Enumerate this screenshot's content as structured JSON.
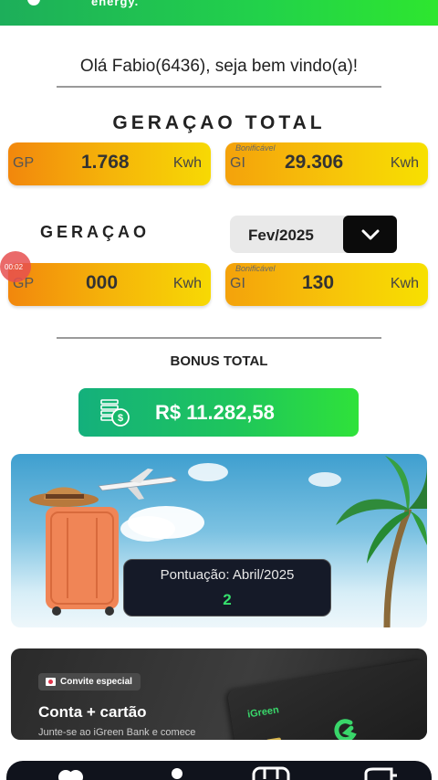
{
  "header": {
    "tagline": "energy."
  },
  "welcome": {
    "text": "Olá Fabio(6436), seja bem vindo(a)!"
  },
  "total_generation": {
    "title": "GERAÇAO  TOTAL",
    "gp": {
      "tag": "GP",
      "value": "1.768",
      "unit": "Kwh"
    },
    "gi": {
      "tag": "GI",
      "bonif_label": "Bonificável",
      "value": "29.306",
      "unit": "Kwh"
    }
  },
  "monthly_generation": {
    "title": "GERAÇAO",
    "selected_month": "Fev/2025",
    "gp": {
      "tag": "GP",
      "value": "000",
      "unit": "Kwh"
    },
    "gi": {
      "tag": "GI",
      "bonif_label": "Bonificável",
      "value": "130",
      "unit": "Kwh"
    }
  },
  "recording": {
    "timer": "00:02"
  },
  "bonus": {
    "title": "BONUS TOTAL",
    "amount": "R$ 11.282,58"
  },
  "promo": {
    "score_label": "Pontuação: Abril/2025",
    "score_value": "2"
  },
  "bank_promo": {
    "badge": "Convite especial",
    "title": "Conta + cartão",
    "subtitle": "Junte-se ao iGreen Bank e comece",
    "card_brand": "iGreen"
  },
  "nav": {
    "icons": [
      "home-icon",
      "profile-icon",
      "calendar-icon",
      "wallet-icon"
    ]
  },
  "colors": {
    "brand_green": "#1ec55c",
    "card_orange": "#f2870c",
    "card_yellow": "#f7e000",
    "dark": "#10131c",
    "score_green": "#36e06d"
  }
}
